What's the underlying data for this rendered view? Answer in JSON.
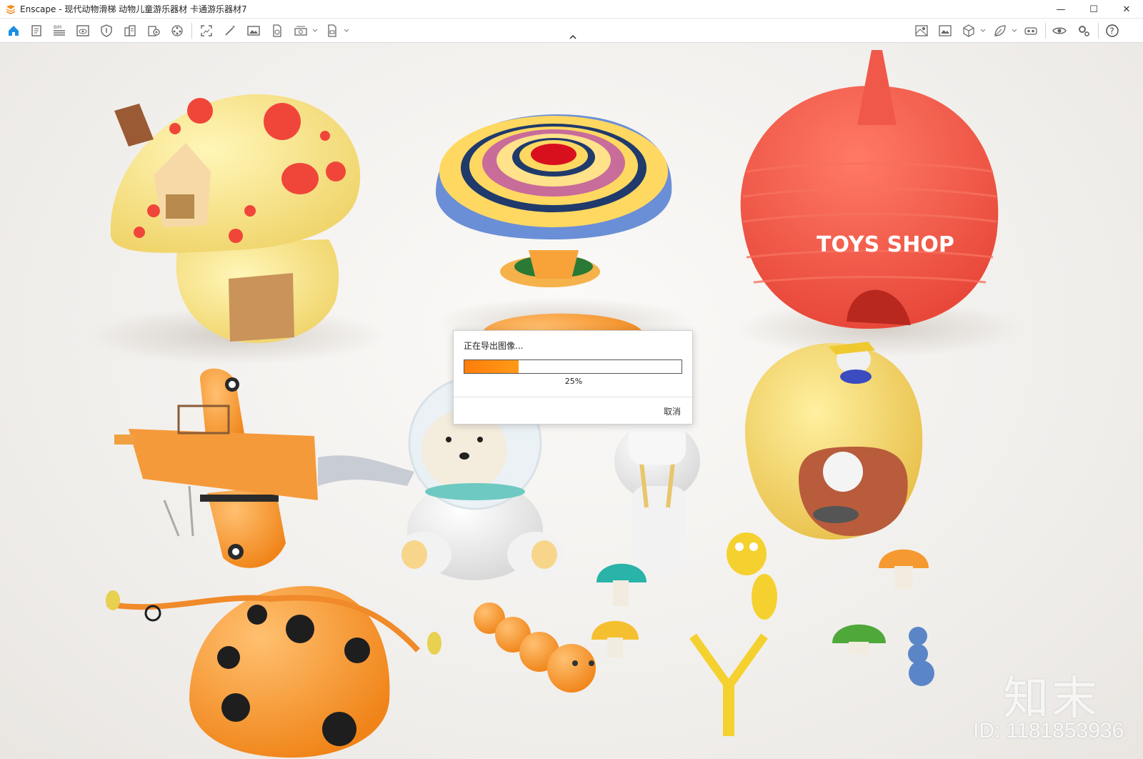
{
  "window": {
    "title": "Enscape - 现代动物滑梯 动物儿童游乐器材 卡通游乐器材7",
    "controls": {
      "minimize": "—",
      "maximize": "☐",
      "close": "✕"
    }
  },
  "toolbar": {
    "icons_left": [
      "home-icon",
      "document-icon",
      "bim-icon",
      "view-eye-icon",
      "shield-icon",
      "building-icon",
      "asset-library-icon",
      "video-reel-icon",
      "screenshot-icon",
      "magic-wand-icon",
      "image-icon",
      "export-file-icon",
      "render-batch-icon",
      "exe-export-icon"
    ],
    "icons_right": [
      "map-icon",
      "panorama-icon",
      "cube-view-icon",
      "leaf-icon",
      "vr-headset-icon",
      "visibility-icon",
      "settings-icon",
      "help-icon"
    ],
    "bim_label": "BIM",
    "help_label": "?"
  },
  "scene": {
    "sign_text": "TOYS SHOP"
  },
  "watermark": {
    "logo_text": "知末",
    "id_text": "ID: 1181853936"
  },
  "export_dialog": {
    "message": "正在导出图像...",
    "progress_percent": 25,
    "progress_label": "25%",
    "cancel_label": "取消",
    "accent_color": "#ff7d0a"
  }
}
